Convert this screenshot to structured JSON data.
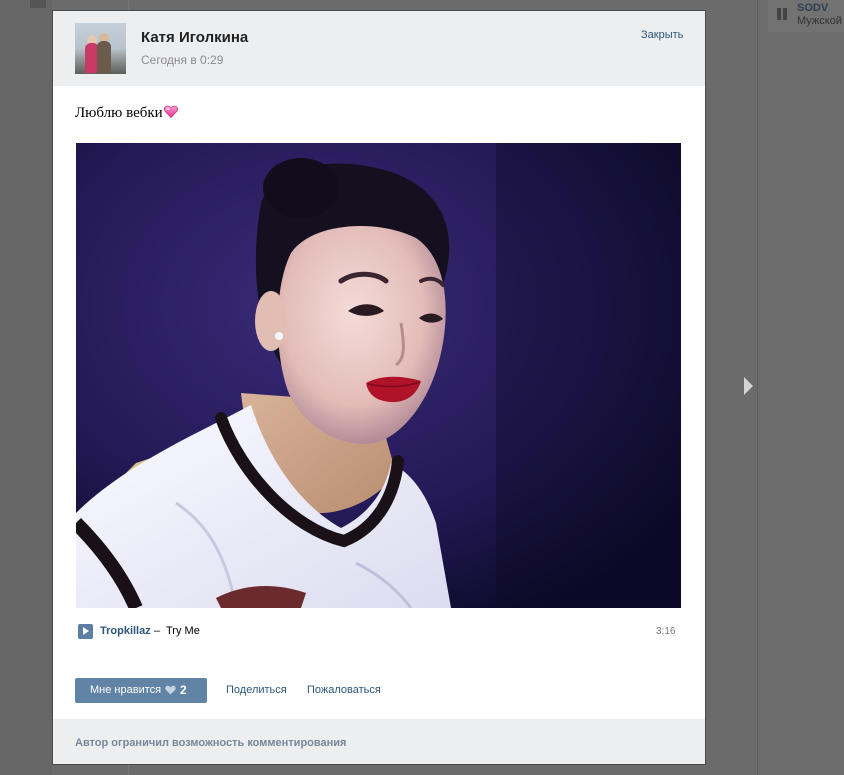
{
  "background": {
    "right_card": {
      "name": "SODV",
      "subtitle": "Мужской"
    }
  },
  "post": {
    "author": {
      "name": "Катя Иголкина",
      "avatar_icon": "user-photo"
    },
    "date": "Сегодня в 0:29",
    "close_label": "Закрыть",
    "text": "Люблю вебки",
    "text_emoji": "pink-heart-icon",
    "photo": {
      "description_icon": "webcam-selfie-photo"
    },
    "audio": {
      "artist": "Tropkillaz",
      "separator": "–",
      "title": "Try Me",
      "duration": "3:16"
    },
    "actions": {
      "like_label": "Мне нравится",
      "like_count": "2",
      "share_label": "Поделиться",
      "report_label": "Пожаловаться"
    },
    "footer_notice": "Автор ограничил возможность комментирования"
  },
  "colors": {
    "link": "#2b587a",
    "like_button": "#6083a6",
    "header_bg": "#edeef0"
  }
}
